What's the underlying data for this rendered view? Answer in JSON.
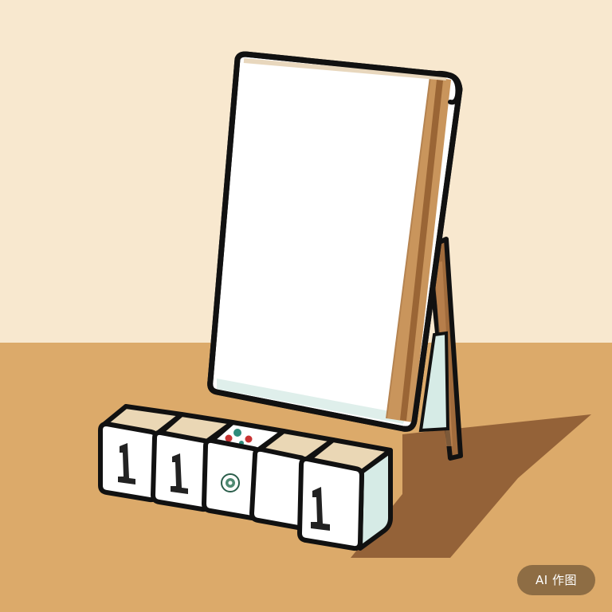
{
  "watermark": {
    "label": "AI 作图"
  },
  "tiles": [
    {
      "face": "1"
    },
    {
      "face": "1"
    },
    {
      "face": "flower"
    },
    {
      "face": "blank"
    },
    {
      "face": "1"
    }
  ],
  "colors": {
    "wall": "#f8e8cf",
    "floor": "#dcaa6a",
    "shadow": "#8c5a33",
    "outline": "#111111",
    "tile_face": "#ffffff",
    "tile_top": "#ead7b5",
    "easel_wood": "#c9955c"
  }
}
